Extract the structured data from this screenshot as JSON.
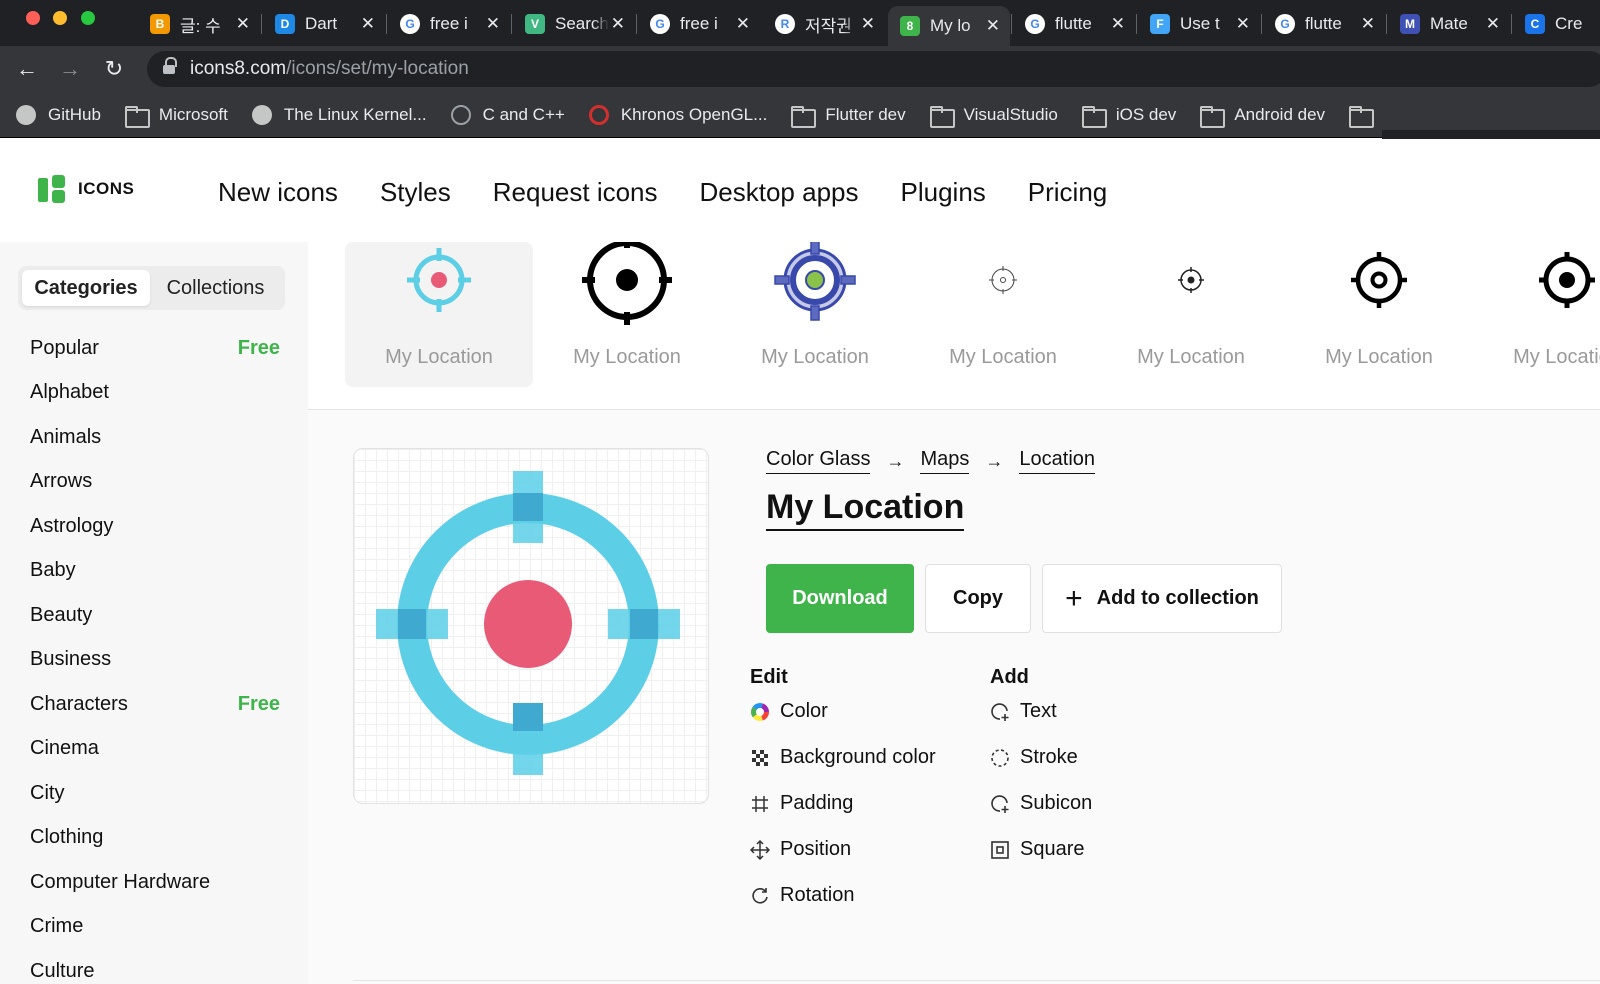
{
  "browser": {
    "tabs": [
      {
        "title": "글: 수",
        "fav_color": "#f29900",
        "fav_text": "B"
      },
      {
        "title": "Dart",
        "fav_color": "#1e88e5",
        "fav_text": "D"
      },
      {
        "title": "free i",
        "fav_color": "#ffffff",
        "fav_text": "G"
      },
      {
        "title": "Search",
        "fav_color": "#41b883",
        "fav_text": "V"
      },
      {
        "title": "free i",
        "fav_color": "#ffffff",
        "fav_text": "G"
      },
      {
        "title": "저작권",
        "fav_color": "#ffffff",
        "fav_text": "R"
      },
      {
        "title": "My lo",
        "fav_color": "#3fb44b",
        "fav_text": "8"
      },
      {
        "title": "flutte",
        "fav_color": "#ffffff",
        "fav_text": "G"
      },
      {
        "title": "Use t",
        "fav_color": "#42a5f5",
        "fav_text": "F"
      },
      {
        "title": "flutte",
        "fav_color": "#ffffff",
        "fav_text": "G"
      },
      {
        "title": "Mate",
        "fav_color": "#3f51b5",
        "fav_text": "M"
      },
      {
        "title": "Cre",
        "fav_color": "#1a73e8",
        "fav_text": "C"
      }
    ],
    "active_tab_index": 6,
    "close_glyph": "✕",
    "url_host": "icons8.com",
    "url_path": "/icons/set/my-location",
    "back_glyph": "←",
    "forward_glyph": "→",
    "reload_glyph": "↻",
    "bookmarks": [
      {
        "label": "GitHub",
        "icon": "github-icon"
      },
      {
        "label": "Microsoft",
        "icon": "folder-icon"
      },
      {
        "label": "The Linux Kernel...",
        "icon": "globe-icon"
      },
      {
        "label": "C and C++",
        "icon": "bug-icon"
      },
      {
        "label": "Khronos OpenGL...",
        "icon": "khronos-icon"
      },
      {
        "label": "Flutter dev",
        "icon": "folder-icon"
      },
      {
        "label": "VisualStudio",
        "icon": "folder-icon"
      },
      {
        "label": "iOS dev",
        "icon": "folder-icon"
      },
      {
        "label": "Android dev",
        "icon": "folder-icon"
      }
    ]
  },
  "site": {
    "logo_text": "ICONS",
    "brand_color": "#3fb44b",
    "nav": [
      "New icons",
      "Styles",
      "Request icons",
      "Desktop apps",
      "Plugins",
      "Pricing"
    ]
  },
  "sidebar": {
    "segments": [
      "Categories",
      "Collections"
    ],
    "categories": [
      {
        "label": "Popular",
        "badge": "Free"
      },
      {
        "label": "Alphabet",
        "badge": ""
      },
      {
        "label": "Animals",
        "badge": ""
      },
      {
        "label": "Arrows",
        "badge": ""
      },
      {
        "label": "Astrology",
        "badge": ""
      },
      {
        "label": "Baby",
        "badge": ""
      },
      {
        "label": "Beauty",
        "badge": ""
      },
      {
        "label": "Business",
        "badge": ""
      },
      {
        "label": "Characters",
        "badge": "Free"
      },
      {
        "label": "Cinema",
        "badge": ""
      },
      {
        "label": "City",
        "badge": ""
      },
      {
        "label": "Clothing",
        "badge": ""
      },
      {
        "label": "Computer Hardware",
        "badge": ""
      },
      {
        "label": "Crime",
        "badge": ""
      },
      {
        "label": "Culture",
        "badge": ""
      }
    ]
  },
  "variants": [
    {
      "label": "My Location",
      "style": "color-glass"
    },
    {
      "label": "My Location",
      "style": "ios-filled"
    },
    {
      "label": "My Location",
      "style": "office"
    },
    {
      "label": "My Location",
      "style": "thin-outline"
    },
    {
      "label": "My Location",
      "style": "small-outline"
    },
    {
      "label": "My Location",
      "style": "bold-outline"
    },
    {
      "label": "My Location",
      "style": "cut"
    }
  ],
  "detail": {
    "breadcrumb": [
      "Color Glass",
      "Maps",
      "Location"
    ],
    "breadcrumb_separator": "→",
    "title": "My Location",
    "download_label": "Download",
    "copy_label": "Copy",
    "add_to_collection_label": "Add to collection",
    "edit_heading": "Edit",
    "add_heading": "Add",
    "edit_options": [
      {
        "label": "Color",
        "icon": "color-wheel-icon"
      },
      {
        "label": "Background color",
        "icon": "checker-icon"
      },
      {
        "label": "Padding",
        "icon": "padding-icon"
      },
      {
        "label": "Position",
        "icon": "move-icon"
      },
      {
        "label": "Rotation",
        "icon": "rotate-icon"
      }
    ],
    "add_options": [
      {
        "label": "Text",
        "icon": "text-bubble-icon"
      },
      {
        "label": "Stroke",
        "icon": "stroke-icon"
      },
      {
        "label": "Subicon",
        "icon": "subicon-icon"
      },
      {
        "label": "Square",
        "icon": "square-icon"
      }
    ],
    "icon_colors": {
      "ring": "#5ccfe6",
      "ring_overlap": "#3fa9d0",
      "dot": "#e85a76"
    }
  }
}
